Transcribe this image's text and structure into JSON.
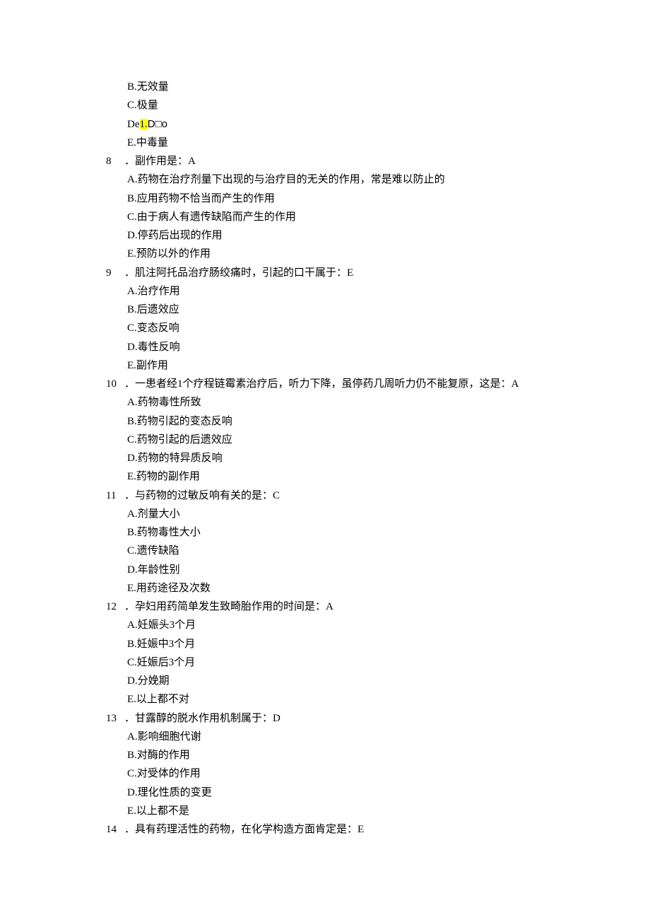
{
  "partial_q7_options": {
    "b": "B.无效量",
    "c": "C.极量",
    "d_pre": "De",
    "d_hl": "1.",
    "d_post": "D□o",
    "e": "E.中毒量"
  },
  "questions": [
    {
      "num": "8",
      "stem": "．副作用是：A",
      "options": [
        "A.药物在治疗剂量下出现的与治疗目的无关的作用，常是难以防止的",
        "B.应用药物不恰当而产生的作用",
        "C.由于病人有遗传缺陷而产生的作用",
        "D.停药后出现的作用",
        "E.预防以外的作用"
      ]
    },
    {
      "num": "9",
      "stem": "．肌注阿托品治疗肠绞痛时，引起的口干属于：E",
      "options": [
        "A.治疗作用",
        "B.后遗效应",
        "C.变态反响",
        "D.毒性反响",
        "E.副作用"
      ]
    },
    {
      "num": "10",
      "stem": "．一患者经1个疗程链霉素治疗后，听力下降，虽停药几周听力仍不能复原，这是：A",
      "options": [
        "A.药物毒性所致",
        "B.药物引起的变态反响",
        "C.药物引起的后遗效应",
        "D.药物的特异质反响",
        "E.药物的副作用"
      ]
    },
    {
      "num": "11",
      "stem": "．与药物的过敏反响有关的是：C",
      "options": [
        "A.剂量大小",
        "B.药物毒性大小",
        "C.遗传缺陷",
        "D.年龄性别",
        "E.用药途径及次数"
      ]
    },
    {
      "num": "12",
      "stem": "．孕妇用药简单发生致畸胎作用的时间是：A",
      "options": [
        "A.妊娠头3个月",
        "B.妊娠中3个月",
        "C.妊娠后3个月",
        "D.分娩期",
        "E.以上都不对"
      ]
    },
    {
      "num": "13",
      "stem": "．甘露醇的脱水作用机制属于：D",
      "options": [
        "A.影响细胞代谢",
        "B.对酶的作用",
        "C.对受体的作用",
        "D.理化性质的变更",
        "E.以上都不是"
      ]
    },
    {
      "num": "14",
      "stem": "．具有药理活性的药物，在化学构造方面肯定是：E",
      "options": []
    }
  ]
}
